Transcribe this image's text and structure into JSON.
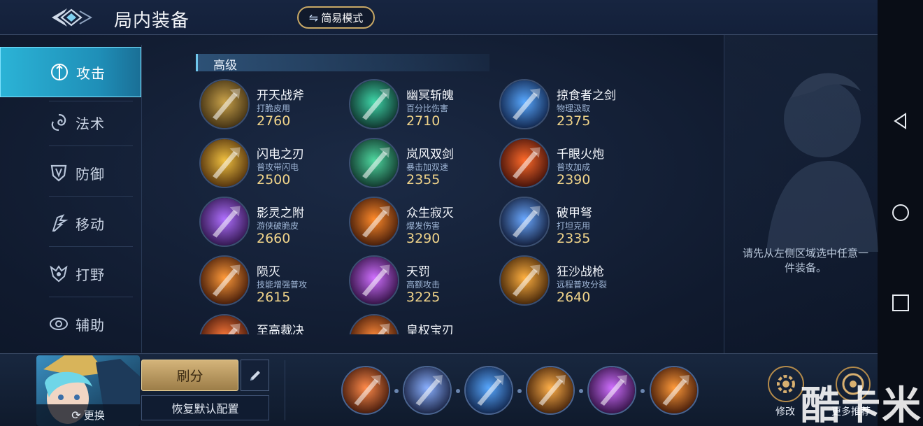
{
  "header": {
    "title": "局内装备",
    "mode_button": "简易模式",
    "mode_icon": "swap-arrows-icon"
  },
  "sidebar": {
    "items": [
      {
        "label": "攻击",
        "icon": "attack-icon",
        "active": true
      },
      {
        "label": "法术",
        "icon": "magic-icon",
        "active": false
      },
      {
        "label": "防御",
        "icon": "defense-icon",
        "active": false
      },
      {
        "label": "移动",
        "icon": "movement-icon",
        "active": false
      },
      {
        "label": "打野",
        "icon": "jungle-icon",
        "active": false
      },
      {
        "label": "辅助",
        "icon": "support-icon",
        "active": false
      }
    ]
  },
  "section": {
    "title": "高级"
  },
  "items": [
    {
      "name": "开天战斧",
      "desc": "打脆皮用",
      "price": "2760",
      "colors": [
        "#c9a24a",
        "#3a2a10"
      ]
    },
    {
      "name": "幽冥斩魄",
      "desc": "百分比伤害",
      "price": "2710",
      "colors": [
        "#3fd6a8",
        "#0c2a26"
      ]
    },
    {
      "name": "掠食者之剑",
      "desc": "物理汲取",
      "price": "2375",
      "colors": [
        "#58a8ff",
        "#0d1f44"
      ]
    },
    {
      "name": "闪电之刃",
      "desc": "普攻带闪电",
      "price": "2500",
      "colors": [
        "#f0c040",
        "#4a2a0a"
      ]
    },
    {
      "name": "岚风双剑",
      "desc": "暴击加双速",
      "price": "2355",
      "colors": [
        "#4fd8a0",
        "#0d2f26"
      ]
    },
    {
      "name": "千眼火炮",
      "desc": "普攻加成",
      "price": "2390",
      "colors": [
        "#ff6a2a",
        "#3a0d08"
      ]
    },
    {
      "name": "影灵之附",
      "desc": "游侠破脆皮",
      "price": "2660",
      "colors": [
        "#b070ff",
        "#2a1144"
      ]
    },
    {
      "name": "众生寂灭",
      "desc": "爆发伤害",
      "price": "3290",
      "colors": [
        "#ff8a2a",
        "#3a1608"
      ]
    },
    {
      "name": "破甲弩",
      "desc": "打坦克用",
      "price": "2335",
      "colors": [
        "#6aa8ff",
        "#0d1630"
      ]
    },
    {
      "name": "陨灭",
      "desc": "技能增强普攻",
      "price": "2615",
      "colors": [
        "#ff9a3a",
        "#3a1406"
      ]
    },
    {
      "name": "天罚",
      "desc": "高额攻击",
      "price": "3225",
      "colors": [
        "#d070ff",
        "#2a0c3a"
      ]
    },
    {
      "name": "狂沙战枪",
      "desc": "远程普攻分裂",
      "price": "2640",
      "colors": [
        "#ffb040",
        "#3a1e06"
      ]
    },
    {
      "name": "至高裁决",
      "desc": "",
      "price": "",
      "colors": [
        "#ff7a3a",
        "#3a1208"
      ]
    },
    {
      "name": "皇权宝刃",
      "desc": "",
      "price": "",
      "colors": [
        "#ff8a3a",
        "#3a1406"
      ]
    }
  ],
  "right_panel": {
    "hint": "请先从左侧区域选中任意一件装备。"
  },
  "bottom": {
    "change_label": "更换",
    "score_button": "刷分",
    "reset_button": "恢复默认配置",
    "slots": [
      {
        "icon": "bow-item-icon",
        "colors": [
          "#ff8a4a",
          "#3a1408"
        ]
      },
      {
        "icon": "boots-item-icon",
        "colors": [
          "#8ab0ff",
          "#141c3a"
        ]
      },
      {
        "icon": "sword-item-icon",
        "colors": [
          "#58a8ff",
          "#0d1f44"
        ]
      },
      {
        "icon": "staff-item-icon",
        "colors": [
          "#ffb04a",
          "#3a1a06"
        ]
      },
      {
        "icon": "potion-item-icon",
        "colors": [
          "#d070ff",
          "#2a0c3a"
        ]
      },
      {
        "icon": "blade-item-icon",
        "colors": [
          "#ff9a3a",
          "#3a1406"
        ]
      }
    ],
    "modify_label": "修改",
    "recommend_label": "更多推荐"
  },
  "watermark": "酷卡米"
}
